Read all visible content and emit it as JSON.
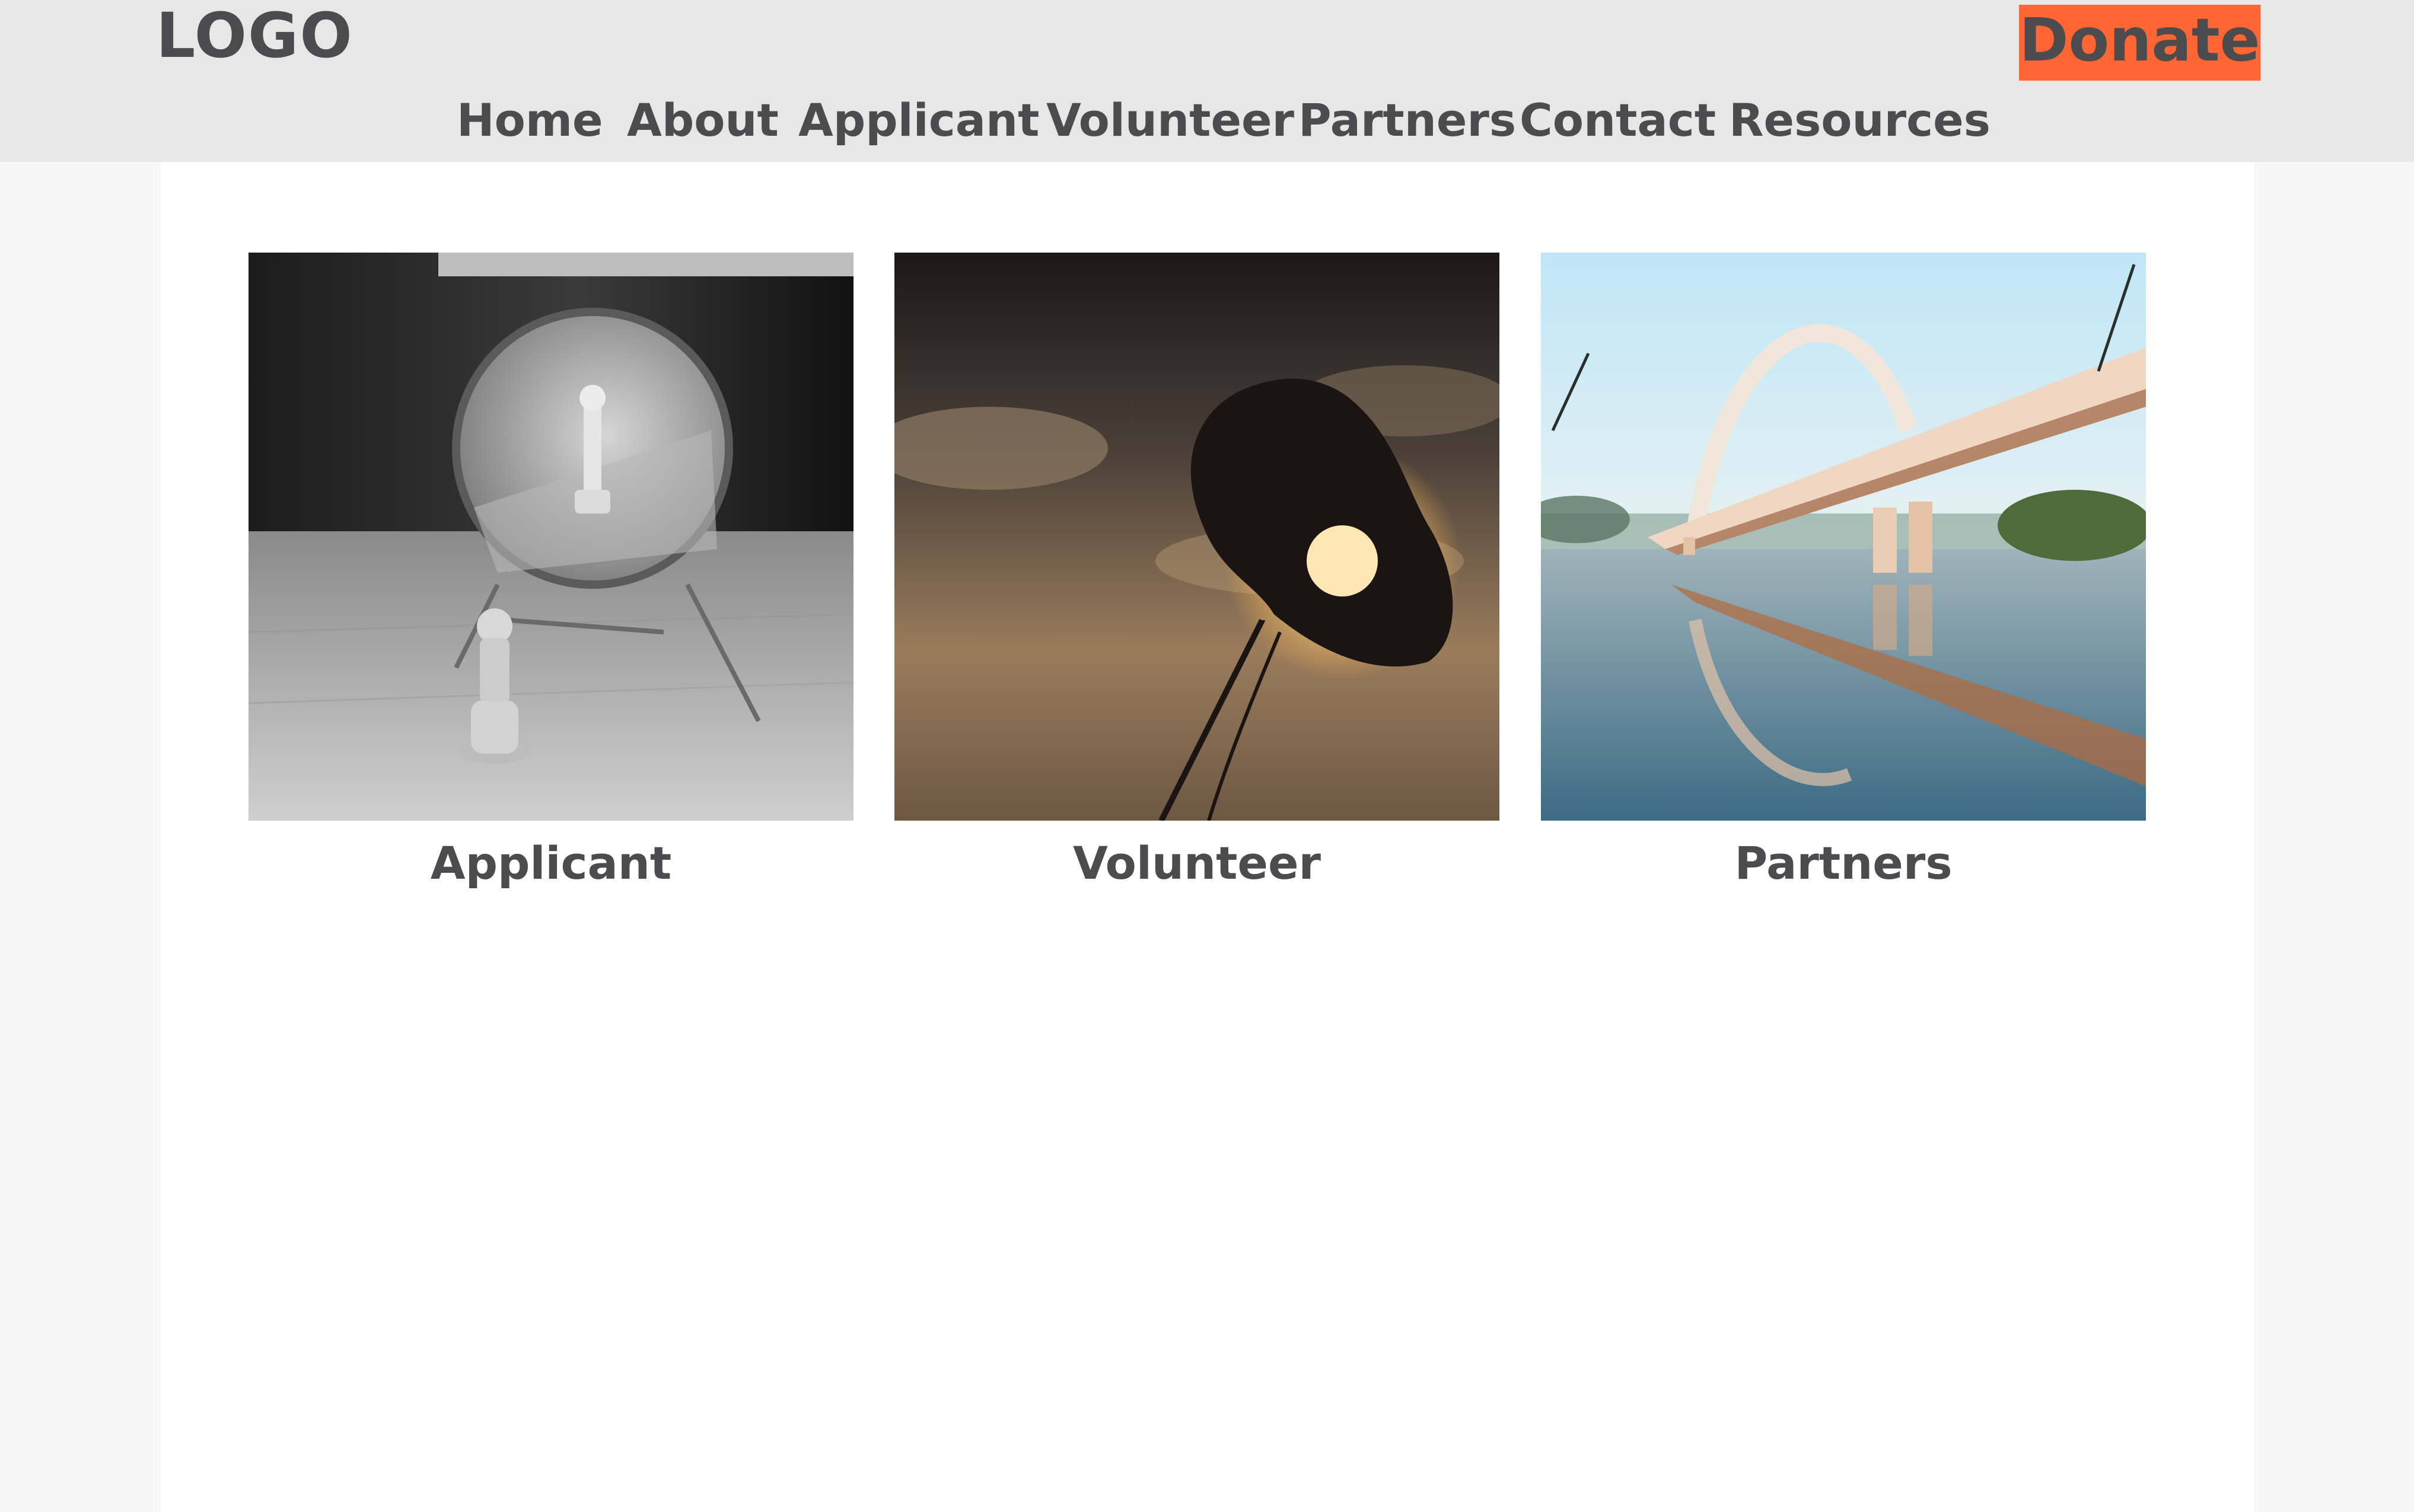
{
  "header": {
    "logo": "LOGO",
    "donate_label": "Donate"
  },
  "nav": {
    "items": [
      {
        "label": "Home"
      },
      {
        "label": "About"
      },
      {
        "label": "Applicant"
      },
      {
        "label": "Volunteer"
      },
      {
        "label": "Partners"
      },
      {
        "label": "Contact"
      },
      {
        "label": "Resources"
      }
    ]
  },
  "cards": [
    {
      "label": "Applicant",
      "image": "chess-mirror-photo"
    },
    {
      "label": "Volunteer",
      "image": "leaf-sunset-photo"
    },
    {
      "label": "Partners",
      "image": "bridge-river-photo"
    }
  ],
  "colors": {
    "header_bg": "#e7e7e7",
    "donate_bg": "#ff6633",
    "text": "#4c4b4d",
    "page_bg": "#f7f7f7",
    "content_bg": "#ffffff"
  }
}
